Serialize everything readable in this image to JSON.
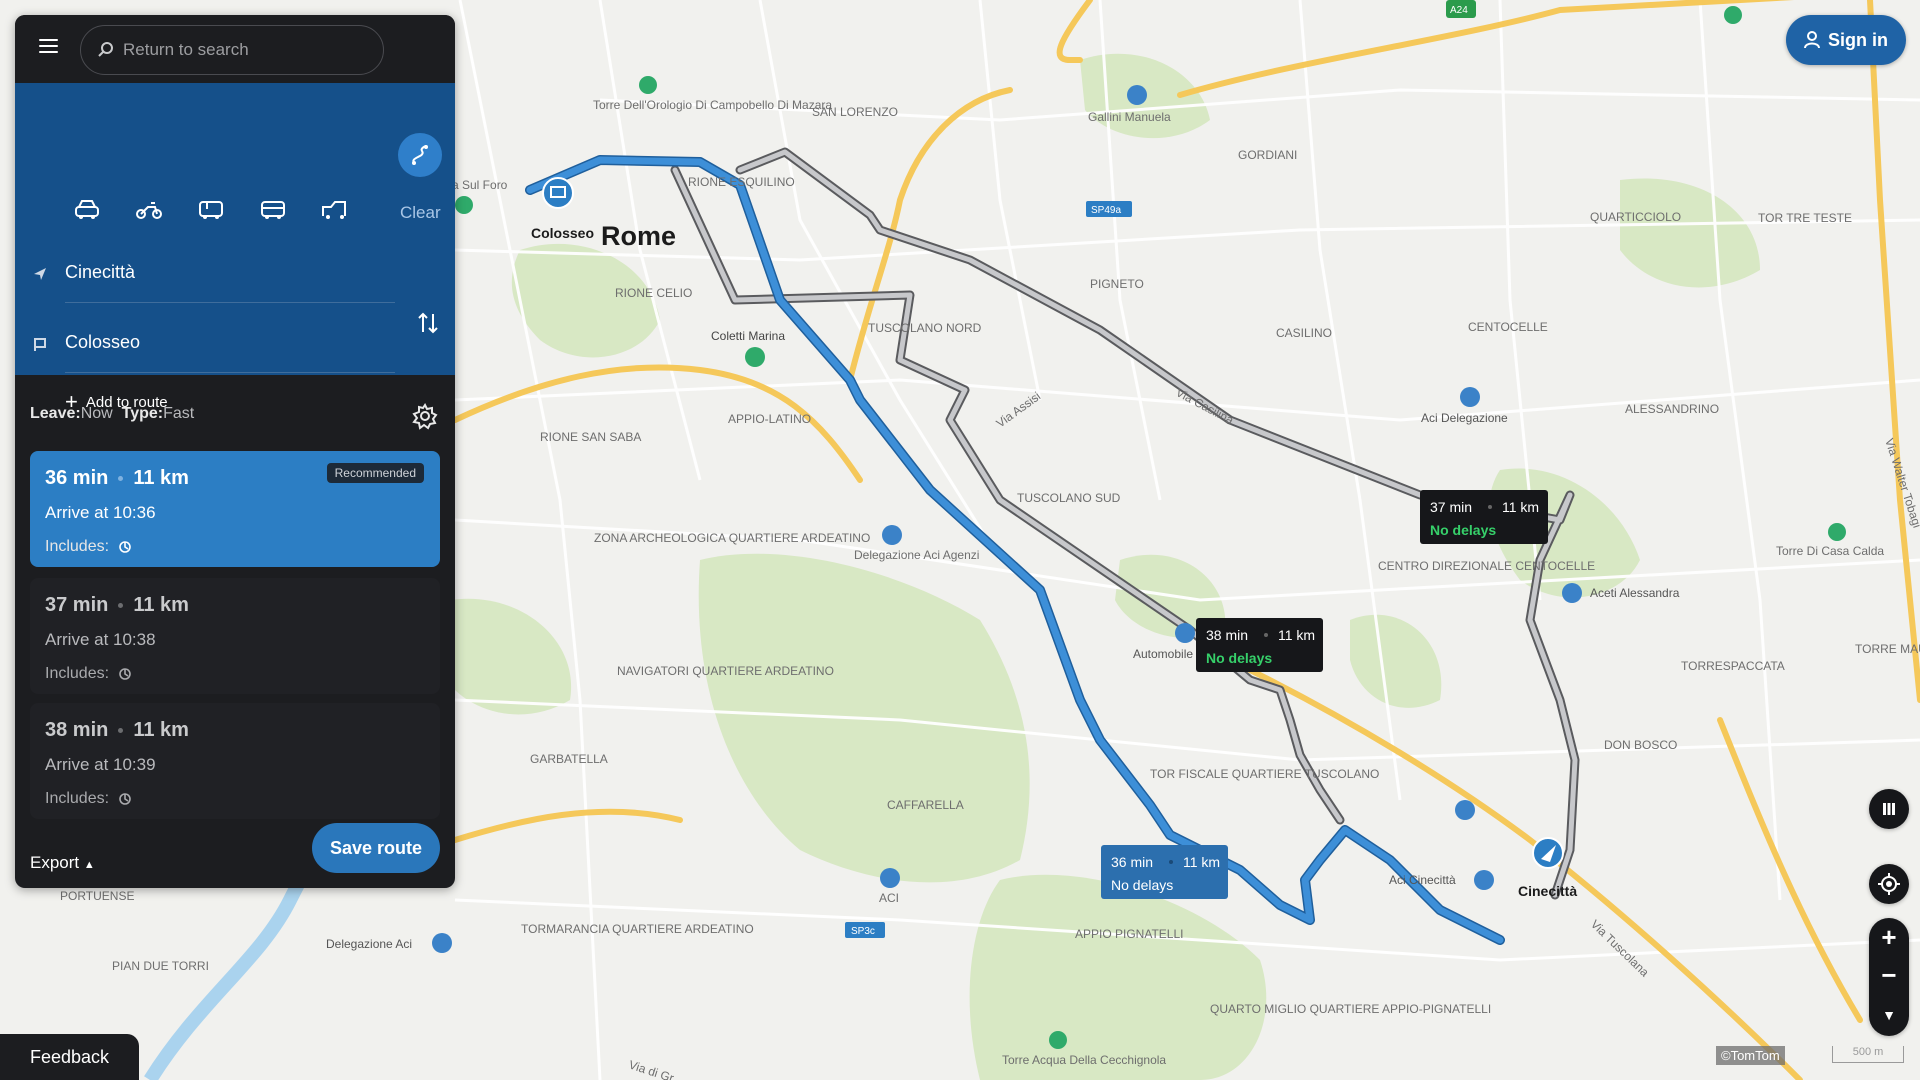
{
  "search": {
    "placeholder": "Return to search"
  },
  "panel": {
    "clear_label": "Clear",
    "origin": "Cinecittà",
    "destination": "Colosseo",
    "add_to_route": "Add to route",
    "leave_label": "Leave:",
    "leave_value": "Now",
    "type_label": "Type:",
    "type_value": "Fast",
    "export_label": "Export",
    "save_label": "Save route",
    "modes": [
      "car-icon",
      "motorcycle-icon",
      "van-icon",
      "bus-icon",
      "truck-icon"
    ]
  },
  "routes": [
    {
      "duration": "36 min",
      "distance": "11 km",
      "arrive": "Arrive at 10:36",
      "includes": "Includes:",
      "badge": "Recommended"
    },
    {
      "duration": "37 min",
      "distance": "11 km",
      "arrive": "Arrive at 10:38",
      "includes": "Includes:"
    },
    {
      "duration": "38 min",
      "distance": "11 km",
      "arrive": "Arrive at 10:39",
      "includes": "Includes:"
    }
  ],
  "map_callouts": [
    {
      "duration": "37 min",
      "distance": "11 km",
      "status": "No delays"
    },
    {
      "duration": "38 min",
      "distance": "11 km",
      "status": "No delays"
    },
    {
      "duration": "36 min",
      "distance": "11 km",
      "status": "No delays"
    }
  ],
  "map_labels": {
    "city": "Rome",
    "start_marker": "Colosseo",
    "end_marker": "Cinecittà",
    "places": [
      "Torre Dell'Orologio Di Campobello Di Mazara",
      "SAN LORENZO",
      "Gallini Manuela",
      "GORDIANI",
      "RIONE ESQUILINO",
      "SP49a",
      "QUARTICCIOLO",
      "TOR TRE TESTE",
      "PIGNETO",
      "CASILINO",
      "CENTOCELLE",
      "RIONE CELIO",
      "Coletti Marina",
      "TUSCOLANO NORD",
      "APPIO-LATINO",
      "Via Assisi",
      "Via Casilina",
      "Aci Delegazione",
      "ALESSANDRINO",
      "RIONE SAN SABA",
      "TUSCOLANO SUD",
      "ZONA ARCHEOLOGICA QUARTIERE ARDEATINO",
      "Delegazione Aci Agenzi",
      "CENTRO DIREZIONALE CENTOCELLE",
      "Aceti Alessandra",
      "Torre Di Casa Calda",
      "NAVIGATORI QUARTIERE ARDEATINO",
      "Automobile Roma",
      "TORRE MAURA",
      "TORRESPACCATA",
      "GARBATELLA",
      "CAFFARELLA",
      "TOR FISCALE QUARTIERE TUSCOLANO",
      "DON BOSCO",
      "Aci Cinecittà",
      "ACI",
      "SP3c",
      "APPIO PIGNATELLI",
      "PORTUENSE",
      "TORMARANCIA QUARTIERE ARDEATINO",
      "Delegazione Aci",
      "PIAN DUE TORRI",
      "QUARTO MIGLIO QUARTIERE APPIO-PIGNATELLI",
      "Torre Acqua Della Cecchignola",
      "Via Tuscolana",
      "Via Walter Tobagi",
      "A24",
      "Via di Gr",
      "a Sul Foro"
    ]
  },
  "header": {
    "sign_in": "Sign in"
  },
  "footer": {
    "feedback": "Feedback",
    "copyright": "©TomTom",
    "scale": "500 m"
  },
  "colors": {
    "route_primary": "#3d8fd8",
    "route_alt": "#8f9094",
    "panel_dark": "#1c1d20",
    "panel_blue": "#15508a",
    "card_selected": "#2c7ec4",
    "status_green": "#36d06a"
  }
}
